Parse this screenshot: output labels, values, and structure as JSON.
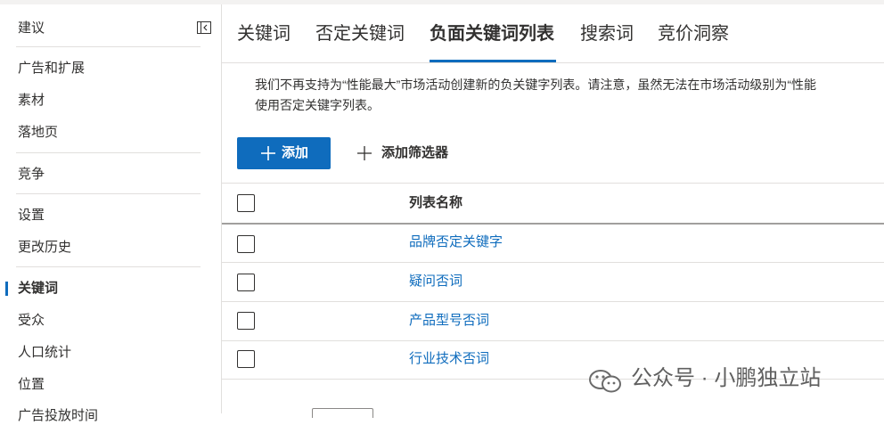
{
  "sidebar": {
    "items": [
      {
        "label": "建议"
      },
      {
        "label": "广告和扩展"
      },
      {
        "label": "素材"
      },
      {
        "label": "落地页"
      },
      {
        "label": "竞争"
      },
      {
        "label": "设置"
      },
      {
        "label": "更改历史"
      },
      {
        "label": "关键词"
      },
      {
        "label": "受众"
      },
      {
        "label": "人口统计"
      },
      {
        "label": "位置"
      },
      {
        "label": "广告投放时间"
      }
    ],
    "active_item": "关键词"
  },
  "tabs": [
    {
      "label": "关键词"
    },
    {
      "label": "否定关键词"
    },
    {
      "label": "负面关键词列表"
    },
    {
      "label": "搜索词"
    },
    {
      "label": "竞价洞察"
    }
  ],
  "active_tab": "负面关键词列表",
  "notice": {
    "line1": "我们不再支持为“性能最大”市场活动创建新的负关键字列表。请注意，虽然无法在市场活动级别为“性能",
    "line2": "使用否定关键字列表。"
  },
  "toolbar": {
    "add_label": "添加",
    "filter_label": "添加筛选器"
  },
  "table": {
    "header": "列表名称",
    "rows": [
      {
        "name": "品牌否定关键字"
      },
      {
        "name": "疑问否词"
      },
      {
        "name": "产品型号否词"
      },
      {
        "name": "行业技术否词"
      }
    ]
  },
  "watermark": {
    "text": "公众号 · 小鹏独立站"
  },
  "colors": {
    "accent": "#0f6cbd",
    "text": "#323130",
    "divider": "#e1dfdd"
  }
}
